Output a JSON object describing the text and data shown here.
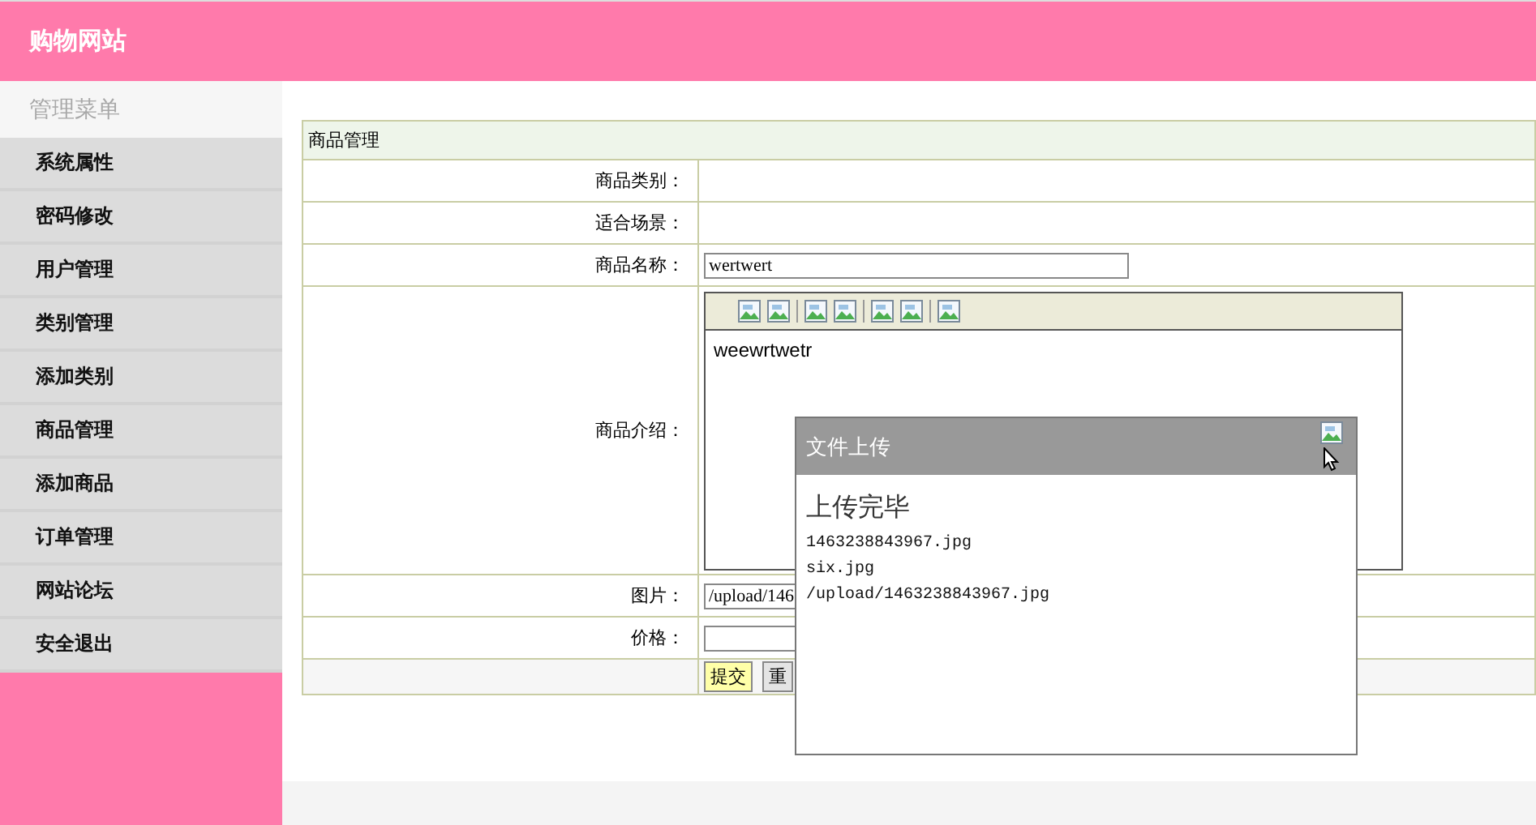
{
  "header": {
    "title": "购物网站"
  },
  "sidebar": {
    "title": "管理菜单",
    "items": [
      {
        "label": "系统属性"
      },
      {
        "label": "密码修改"
      },
      {
        "label": "用户管理"
      },
      {
        "label": "类别管理"
      },
      {
        "label": "添加类别"
      },
      {
        "label": "商品管理"
      },
      {
        "label": "添加商品"
      },
      {
        "label": "订单管理"
      },
      {
        "label": "网站论坛"
      },
      {
        "label": "安全退出"
      }
    ]
  },
  "form": {
    "title": "商品管理",
    "rows": [
      {
        "kind": "text",
        "label": "商品类别："
      },
      {
        "kind": "text",
        "label": "适合场景："
      },
      {
        "kind": "input",
        "label": "商品名称：",
        "value": "wertwert"
      },
      {
        "kind": "editor",
        "label": "商品介绍：",
        "content": "weewrtwetr"
      },
      {
        "kind": "input",
        "label": "图片：",
        "value": "/upload/146"
      },
      {
        "kind": "input",
        "label": "价格："
      }
    ],
    "buttons": [
      {
        "kind": "primary",
        "label": "提交"
      },
      {
        "kind": "default",
        "label": "重"
      }
    ]
  },
  "popup": {
    "title": "文件上传",
    "heading": "上传完毕",
    "lines": [
      "1463238843967.jpg",
      "six.jpg",
      "/upload/1463238843967.jpg"
    ]
  }
}
